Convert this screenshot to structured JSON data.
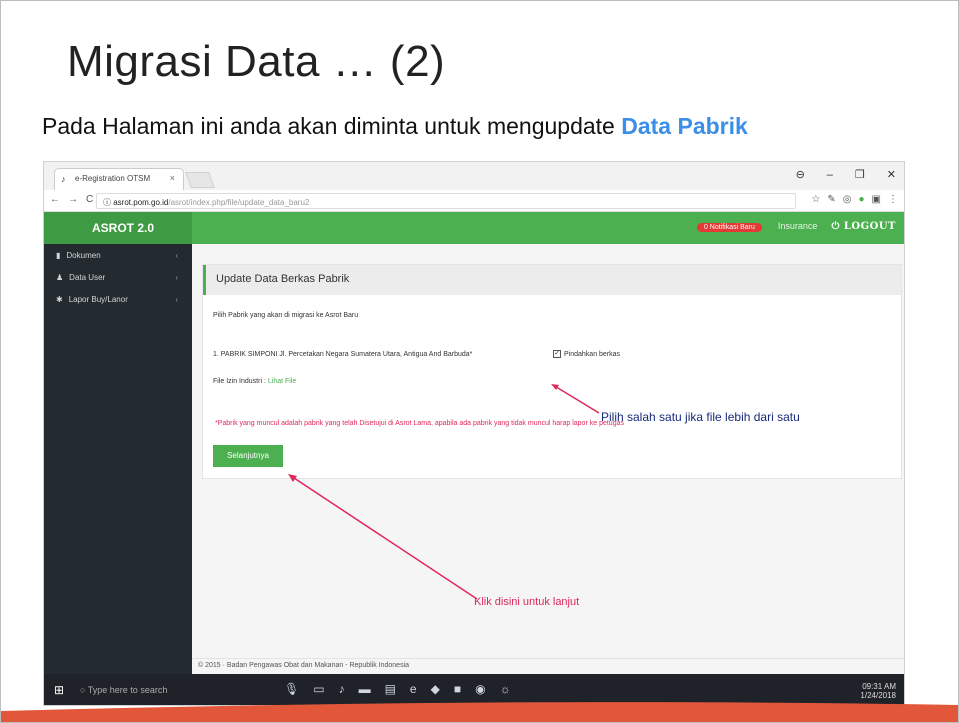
{
  "slide": {
    "title": "Migrasi Data … (2)",
    "subtitle_prefix": "Pada Halaman ini anda akan diminta untuk mengupdate ",
    "subtitle_highlight": "Data Pabrik"
  },
  "browser": {
    "tab_title": "e-Registration OTSM",
    "url_domain": "asrot.pom.go.id",
    "url_path": "/asrot/index.php/file/update_data_baru2",
    "window_controls": [
      "⊖",
      "–",
      "❐",
      "✕"
    ]
  },
  "app": {
    "brand": "ASROT 2.0",
    "notification_badge": "0 Notifikasi Baru",
    "user": "Insurance",
    "logout_label": "LOGOUT",
    "sidebar": [
      {
        "label": "Dokumen",
        "icon": "file-icon"
      },
      {
        "label": "Data User",
        "icon": "user-icon"
      },
      {
        "label": "Lapor Buy/Lanor",
        "icon": "report-icon"
      }
    ],
    "panel_title": "Update Data Berkas Pabrik",
    "instruction": "Pilih Pabrik yang akan di migrasi ke Asrot Baru",
    "factory_line": "1. PABRIK SIMPONI Jl. Percetakan Negara Sumatera Utara, Antigua And Barbuda*",
    "checkbox_label": "Pindahkan berkas",
    "file_label": "File Izin Industri :",
    "file_link": "Lihat File",
    "note": "*Pabrik yang muncul adalah pabrik yang telah Disetujui di Asrot Lama, apabila ada pabrik yang tidak muncul harap lapor ke petugas",
    "next_button": "Selanjutnya",
    "footer": "© 2015 · Badan Pengawas Obat dan Makanan - Republik Indonesia"
  },
  "taskbar": {
    "search_placeholder": "Type here to search",
    "time": "09:31 AM",
    "date": "1/24/2018"
  },
  "annotations": {
    "checkbox_hint": "Pilih salah satu jika file lebih dari satu",
    "button_hint": "Klik disini untuk lanjut"
  },
  "colors": {
    "accent_green": "#4caf50",
    "highlight_blue": "#3b8fe8",
    "annotation_pink": "#e0285a"
  }
}
